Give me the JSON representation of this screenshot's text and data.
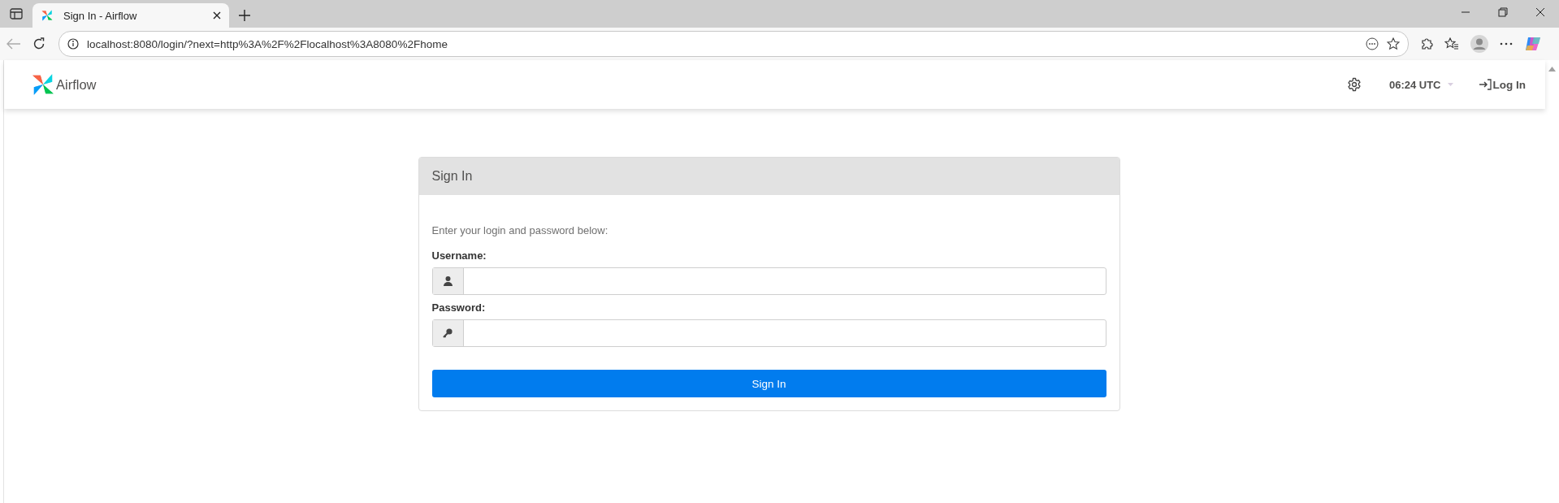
{
  "browser": {
    "tab_title": "Sign In - Airflow",
    "url": "localhost:8080/login/?next=http%3A%2F%2Flocalhost%3A8080%2Fhome"
  },
  "navbar": {
    "brand": "Airflow",
    "time": "06:24 UTC",
    "login_link": "Log In"
  },
  "card": {
    "title": "Sign In",
    "instructions": "Enter your login and password below:",
    "fields": [
      {
        "label": "Username:",
        "kind": "user"
      },
      {
        "label": "Password:",
        "kind": "password"
      }
    ],
    "submit": "Sign In"
  }
}
